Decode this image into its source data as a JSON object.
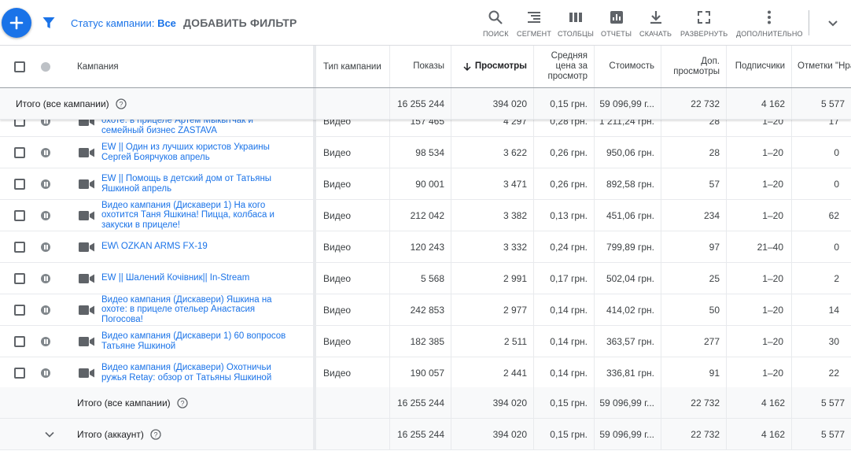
{
  "toolbar": {
    "status_label": "Статус кампании:",
    "status_value": "Все",
    "add_filter": "ДОБАВИТЬ ФИЛЬТР",
    "tools": [
      {
        "label": "ПОИСК",
        "icon": "search-icon"
      },
      {
        "label": "СЕГМЕНТ",
        "icon": "segment-icon"
      },
      {
        "label": "СТОЛБЦЫ",
        "icon": "columns-icon"
      },
      {
        "label": "ОТЧЕТЫ",
        "icon": "reports-icon"
      },
      {
        "label": "СКАЧАТЬ",
        "icon": "download-icon"
      },
      {
        "label": "РАЗВЕРНУТЬ",
        "icon": "expand-icon"
      },
      {
        "label": "ДОПОЛНИТЕЛЬНО",
        "icon": "more-icon"
      }
    ]
  },
  "header": {
    "campaign": "Кампания",
    "type": "Тип кампании",
    "impressions": "Показы",
    "views": "Просмотры",
    "avg_cpv": "Средняя цена за просмотр",
    "cost": "Стоимость",
    "extra_views": "Доп. просмотры",
    "subscribers": "Подписчики",
    "likes": "Отметки \"Нравится\""
  },
  "summary_top": {
    "label": "Итого (все кампании)",
    "impressions": "16 255 244",
    "views": "394 020",
    "avg_cpv": "0,15 грн.",
    "cost": "59 096,99 г...",
    "extra_views": "22 732",
    "subscribers": "4 162",
    "likes": "5 577"
  },
  "partial_row": {
    "name": "охоте: в прицеле Артем Мыкытчак и семейный бизнес ZASTAVA",
    "type": "Видео",
    "impressions": "157 465",
    "views": "4 297",
    "avg_cpv": "0,28 грн.",
    "cost": "1 211,24 грн.",
    "extra_views": "28",
    "subscribers": "1–20",
    "likes": "17"
  },
  "rows": [
    {
      "name": "EW || Один из лучших юристов Украины Сергей Боярчуков апрель",
      "type": "Видео",
      "impressions": "98 534",
      "views": "3 622",
      "avg_cpv": "0,26 грн.",
      "cost": "950,06 грн.",
      "extra_views": "28",
      "subscribers": "1–20",
      "likes": "0"
    },
    {
      "name": "EW || Помощь в детский дом от Татьяны Яшкиной апрель",
      "type": "Видео",
      "impressions": "90 001",
      "views": "3 471",
      "avg_cpv": "0,26 грн.",
      "cost": "892,58 грн.",
      "extra_views": "57",
      "subscribers": "1–20",
      "likes": "0"
    },
    {
      "name": "Видео кампания (Дискавери 1) На кого охотится Таня Яшкина! Пицца, колбаса и закуски в прицеле!",
      "type": "Видео",
      "impressions": "212 042",
      "views": "3 382",
      "avg_cpv": "0,13 грн.",
      "cost": "451,06 грн.",
      "extra_views": "234",
      "subscribers": "1–20",
      "likes": "62"
    },
    {
      "name": "EW\\ OZKAN ARMS FX-19",
      "type": "Видео",
      "impressions": "120 243",
      "views": "3 332",
      "avg_cpv": "0,24 грн.",
      "cost": "799,89 грн.",
      "extra_views": "97",
      "subscribers": "21–40",
      "likes": "0"
    },
    {
      "name": "EW || Шалений Кочівник|| In-Stream",
      "type": "Видео",
      "impressions": "5 568",
      "views": "2 991",
      "avg_cpv": "0,17 грн.",
      "cost": "502,04 грн.",
      "extra_views": "25",
      "subscribers": "1–20",
      "likes": "2"
    },
    {
      "name": "Видео кампания (Дискавери) Яшкина на охоте: в прицеле отельер Анастасия Погосова!",
      "type": "Видео",
      "impressions": "242 853",
      "views": "2 977",
      "avg_cpv": "0,14 грн.",
      "cost": "414,02 грн.",
      "extra_views": "50",
      "subscribers": "1–20",
      "likes": "14"
    },
    {
      "name": "Видео кампания (Дискавери 1) 60 вопросов Татьяне Яшкиной",
      "type": "Видео",
      "impressions": "182 385",
      "views": "2 511",
      "avg_cpv": "0,14 грн.",
      "cost": "363,57 грн.",
      "extra_views": "277",
      "subscribers": "1–20",
      "likes": "30"
    },
    {
      "name": "Видео кампания (Дискавери) Охотничьи ружья Retay: обзор от Татьяны Яшкиной",
      "type": "Видео",
      "impressions": "190 057",
      "views": "2 441",
      "avg_cpv": "0,14 грн.",
      "cost": "336,81 грн.",
      "extra_views": "91",
      "subscribers": "1–20",
      "likes": "22"
    }
  ],
  "summary_bottom": {
    "label": "Итого (все кампании)",
    "impressions": "16 255 244",
    "views": "394 020",
    "avg_cpv": "0,15 грн.",
    "cost": "59 096,99 г...",
    "extra_views": "22 732",
    "subscribers": "4 162",
    "likes": "5 577"
  },
  "summary_account": {
    "label": "Итого (аккаунт)",
    "impressions": "16 255 244",
    "views": "394 020",
    "avg_cpv": "0,15 грн.",
    "cost": "59 096,99 г...",
    "extra_views": "22 732",
    "subscribers": "4 162",
    "likes": "5 577"
  }
}
